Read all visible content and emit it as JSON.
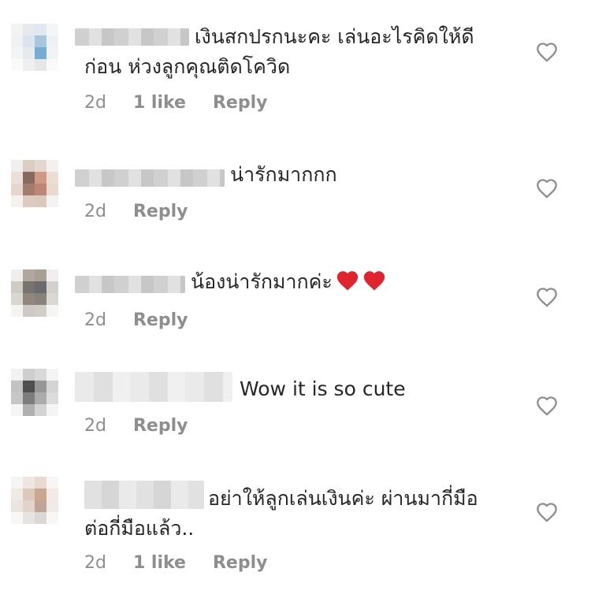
{
  "comments": [
    {
      "line1": "เงินสกปรกนะคะ เล่นอะไรคิดให้ดี",
      "line2": "ก่อน ห่วงลูกคุณติดโควิด",
      "time": "2d",
      "likes": "1 like",
      "reply": "Reply"
    },
    {
      "line1": "น่ารักมากกก",
      "time": "2d",
      "reply": "Reply"
    },
    {
      "line1": "น้องน่ารักมากค่ะ",
      "time": "2d",
      "reply": "Reply"
    },
    {
      "line1": "Wow it is so cute",
      "time": "2d",
      "reply": "Reply"
    },
    {
      "line1": "อย่าให้ลูกเล่นเงินค่ะ ผ่านมากี่มือ",
      "line2": "ต่อกี่มือแล้ว..",
      "time": "2d",
      "likes": "1 like",
      "reply": "Reply"
    }
  ],
  "icons": {
    "like": "heart-outline-icon",
    "emoji": "red-heart-emoji"
  },
  "colors": {
    "text": "#262626",
    "meta": "#8e8e8e",
    "heart_emoji": "#e0242f"
  }
}
